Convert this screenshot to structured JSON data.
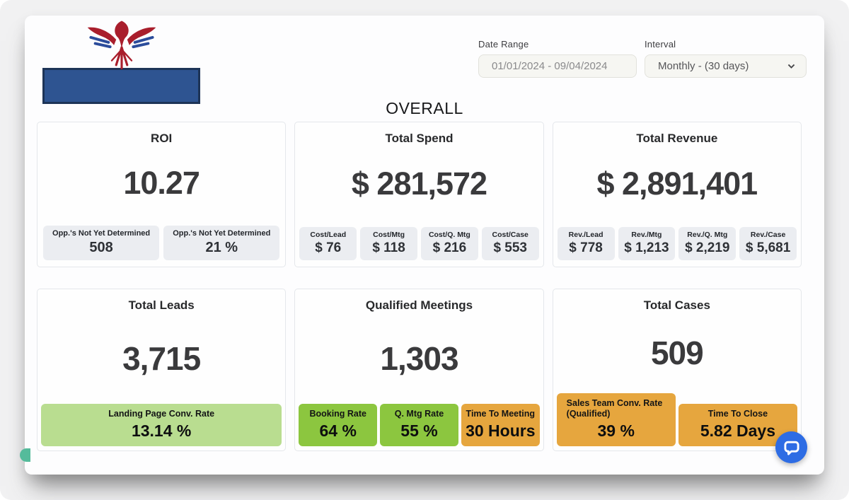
{
  "header": {
    "logo": {
      "icon": "eagle-logo-icon",
      "redacted_block_color": "#2e5491"
    },
    "date_range": {
      "label": "Date Range",
      "value": "01/01/2024 - 09/04/2024"
    },
    "interval": {
      "label": "Interval",
      "value": "Monthly - (30 days)",
      "icon": "chevron-down-icon"
    }
  },
  "section_title": "OVERALL",
  "cards": [
    {
      "title": "ROI",
      "value": "10.27",
      "substats": [
        {
          "label": "Opp.'s Not Yet Determined",
          "value": "508",
          "style": "gray"
        },
        {
          "label": "Opp.'s Not Yet Determined",
          "value": "21 %",
          "style": "gray"
        }
      ]
    },
    {
      "title": "Total Spend",
      "value": "$ 281,572",
      "substats": [
        {
          "label": "Cost/Lead",
          "value": "$ 76",
          "style": "gray"
        },
        {
          "label": "Cost/Mtg",
          "value": "$ 118",
          "style": "gray"
        },
        {
          "label": "Cost/Q. Mtg",
          "value": "$ 216",
          "style": "gray"
        },
        {
          "label": "Cost/Case",
          "value": "$ 553",
          "style": "gray"
        }
      ]
    },
    {
      "title": "Total Revenue",
      "value": "$ 2,891,401",
      "substats": [
        {
          "label": "Rev./Lead",
          "value": "$ 778",
          "style": "gray"
        },
        {
          "label": "Rev./Mtg",
          "value": "$ 1,213",
          "style": "gray"
        },
        {
          "label": "Rev./Q. Mtg",
          "value": "$ 2,219",
          "style": "gray"
        },
        {
          "label": "Rev./Case",
          "value": "$ 5,681",
          "style": "gray"
        }
      ]
    },
    {
      "title": "Total Leads",
      "value": "3,715",
      "substats": [
        {
          "label": "Landing Page Conv. Rate",
          "value": "13.14 %",
          "style": "lightgreen"
        }
      ]
    },
    {
      "title": "Qualified Meetings",
      "value": "1,303",
      "substats": [
        {
          "label": "Booking Rate",
          "value": "64 %",
          "style": "green"
        },
        {
          "label": "Q. Mtg Rate",
          "value": "55 %",
          "style": "green"
        },
        {
          "label": "Time To Meeting",
          "value": "30 Hours",
          "style": "orange"
        }
      ]
    },
    {
      "title": "Total Cases",
      "value": "509",
      "substats": [
        {
          "label": "Sales Team Conv. Rate (Qualified)",
          "value": "39 %",
          "style": "orange",
          "align": "left"
        },
        {
          "label": "Time To Close",
          "value": "5.82 Days",
          "style": "orange"
        }
      ]
    }
  ],
  "widgets": {
    "chat": {
      "icon": "chat-bubble-icon",
      "color": "#2d6ce4"
    },
    "side_tab": {
      "icon": "accessibility-tab-icon",
      "color": "#55bb9b"
    }
  },
  "colors": {
    "substat_gray": "#ebedf1",
    "light_green": "#b9dd90",
    "green": "#8cc63f",
    "orange": "#e6a63e",
    "logo_red": "#a91e2c",
    "logo_blue": "#2b4c9b"
  }
}
